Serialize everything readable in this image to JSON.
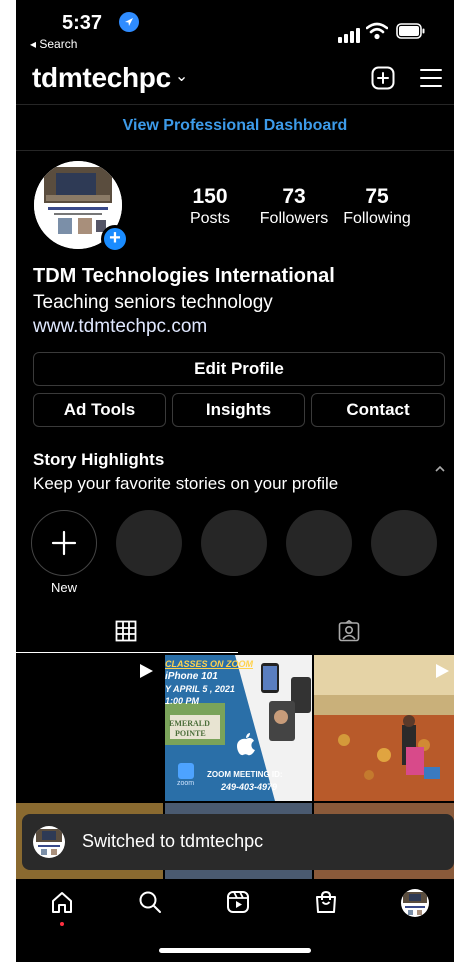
{
  "status_bar": {
    "time": "5:37",
    "back_label": "◂ Search"
  },
  "header": {
    "username": "tdmtechpc",
    "chevron": "⌄",
    "new_post_icon": "plus-square-icon",
    "menu_icon": "hamburger-icon"
  },
  "dashboard_link": "View Professional Dashboard",
  "profile": {
    "stats": [
      {
        "value": "150",
        "label": "Posts"
      },
      {
        "value": "73",
        "label": "Followers"
      },
      {
        "value": "75",
        "label": "Following"
      }
    ],
    "name": "TDM Technologies International",
    "description": "Teaching seniors technology",
    "link": "www.tdmtechpc.com"
  },
  "buttons": {
    "edit_profile": "Edit Profile",
    "ad_tools": "Ad Tools",
    "insights": "Insights",
    "contact": "Contact"
  },
  "highlights": {
    "title": "Story Highlights",
    "subtitle": "Keep your favorite stories on your profile",
    "collapse_icon": "chevron-up-icon",
    "new_label": "New"
  },
  "tabs": {
    "grid_icon": "grid-icon",
    "tagged_icon": "tagged-person-icon"
  },
  "grid_post": {
    "line1": "CLASSES ON ZOOM",
    "line2": "iPhone 101",
    "line3": "Y APRIL 5 , 2021",
    "line4": "1:00 PM",
    "sign1": "EMERALD",
    "sign2": "POINTE",
    "zoom_app": "zoom",
    "meeting_label": "ZOOM MEETING ID:",
    "meeting_id": "249-403-4979"
  },
  "toast": {
    "message": "Switched to tdmtechpc"
  },
  "bottom_nav": [
    "home-icon",
    "search-icon",
    "reels-icon",
    "shop-icon",
    "profile-avatar"
  ],
  "colors": {
    "accent_link": "#3d9be9",
    "badge_blue": "#1a8cff",
    "background": "#000000",
    "divider": "#262626"
  }
}
